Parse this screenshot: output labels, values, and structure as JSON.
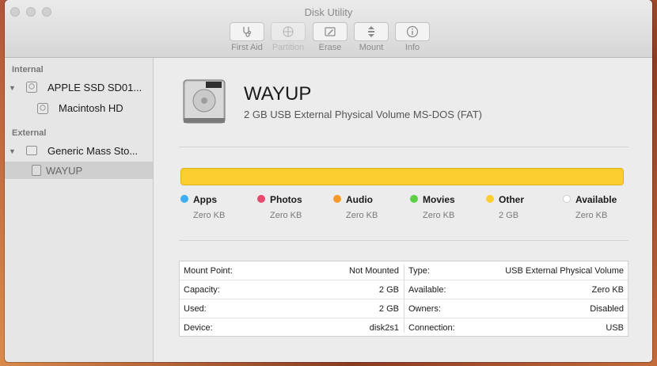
{
  "window": {
    "title": "Disk Utility"
  },
  "toolbar": {
    "buttons": [
      {
        "label": "First Aid",
        "icon": "stethoscope-icon",
        "enabled": true
      },
      {
        "label": "Partition",
        "icon": "partition-icon",
        "enabled": false
      },
      {
        "label": "Erase",
        "icon": "erase-icon",
        "enabled": true
      },
      {
        "label": "Mount",
        "icon": "mount-icon",
        "enabled": true
      },
      {
        "label": "Info",
        "icon": "info-icon",
        "enabled": true
      }
    ]
  },
  "sidebar": {
    "sections": [
      {
        "header": "Internal",
        "items": [
          {
            "label": "APPLE SSD SD01...",
            "level": 0
          },
          {
            "label": "Macintosh HD",
            "level": 1
          }
        ]
      },
      {
        "header": "External",
        "items": [
          {
            "label": "Generic Mass Sto...",
            "level": 0
          },
          {
            "label": "WAYUP",
            "level": 1,
            "selected": true
          }
        ]
      }
    ]
  },
  "volume": {
    "name": "WAYUP",
    "description": "2 GB USB External Physical Volume MS-DOS (FAT)"
  },
  "usage": {
    "bar_color": "#fccf2e",
    "categories": [
      {
        "name": "Apps",
        "value": "Zero KB",
        "color": "#3daef3"
      },
      {
        "name": "Photos",
        "value": "Zero KB",
        "color": "#e8476e"
      },
      {
        "name": "Audio",
        "value": "Zero KB",
        "color": "#f59a2a"
      },
      {
        "name": "Movies",
        "value": "Zero KB",
        "color": "#5ccf45"
      },
      {
        "name": "Other",
        "value": "2 GB",
        "color": "#fccf2e"
      },
      {
        "name": "Available",
        "value": "Zero KB",
        "color": "#ffffff"
      }
    ]
  },
  "info": {
    "left": [
      {
        "key": "Mount Point:",
        "value": "Not Mounted"
      },
      {
        "key": "Capacity:",
        "value": "2 GB"
      },
      {
        "key": "Used:",
        "value": "2 GB"
      },
      {
        "key": "Device:",
        "value": "disk2s1"
      }
    ],
    "right": [
      {
        "key": "Type:",
        "value": "USB External Physical Volume"
      },
      {
        "key": "Available:",
        "value": "Zero KB"
      },
      {
        "key": "Owners:",
        "value": "Disabled"
      },
      {
        "key": "Connection:",
        "value": "USB"
      }
    ]
  }
}
